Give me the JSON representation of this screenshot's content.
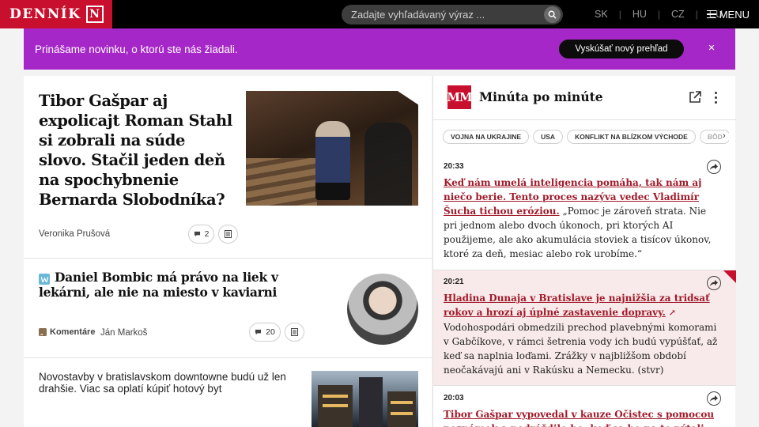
{
  "header": {
    "logo_text": "DENNÍK",
    "logo_mark": "N",
    "search_placeholder": "Zadajte vyhľadávaný výraz ...",
    "languages": [
      "SK",
      "HU",
      "CZ",
      "EU"
    ],
    "menu_label": "MENU"
  },
  "promo": {
    "text": "Prinášame novinku, o ktorú ste nás žiadali.",
    "button_label": "Vyskúšať nový prehľad",
    "close_label": "×"
  },
  "articles": [
    {
      "headline": "Tibor Gašpar aj expolicajt Roman Stahl si zobrali na súde slovo. Stačil jeden deň na spochybnenie Bernarda Slobodníka?",
      "author": "Veronika Prušová",
      "comments": "2"
    },
    {
      "headline": "Daniel Bombic má právo na liek v lekárni, ale nie na miesto v kaviarni",
      "section": "Komentáre",
      "author": "Ján Markoš",
      "comments": "20"
    },
    {
      "headline": "Novostavby v bratislavskom downtowne budú už len drahšie. Viac sa oplatí kúpiť hotový byt"
    }
  ],
  "live": {
    "logo": "MM",
    "title": "Minúta po minúte",
    "chips": [
      "VOJNA NA UKRAJINE",
      "USA",
      "KONFLIKT NA BLÍZKOM VÝCHODE",
      "BÔD"
    ],
    "entries": [
      {
        "time": "20:33",
        "lead": "Keď nám umelá inteligencia pomáha, tak nám aj niečo berie. Tento proces nazýva vedec Vladimír Šucha tichou eróziou.",
        "text": " „Pomoc je zároveň strata. Nie pri jednom alebo dvoch úkonoch, pri ktorých AI použijeme, ale ako akumulácia stoviek a tisícov úkonov, ktoré za deň, mesiac alebo rok urobíme.“"
      },
      {
        "time": "20:21",
        "lead": "Hladina Dunaja v Bratislave je najnižšia za tridsať rokov a hrozí aj úplné zastavenie dopravy.",
        "arrow": "↗",
        "text": " Vodohospodári obmedzili prechod plavebnými komorami v Gabčíkove, v rámci šetrenia vody ich budú vypúšťať, až keď sa naplnia loďami. Zrážky v najbližšom období neočakávajú ani v Rakúsku a Nemecku. (stvr)"
      },
      {
        "time": "20:03",
        "lead": "Tibor Gašpar vypovedal v kauze Očistec s pomocou poznámok a podráždilo ho, keď sa ho na to pýtali",
        "text": ""
      }
    ]
  },
  "colors": {
    "brand_red": "#c8102e",
    "promo_purple": "#a627c8",
    "link_red": "#a11a2a",
    "live_highlight": "#f8eaea"
  }
}
